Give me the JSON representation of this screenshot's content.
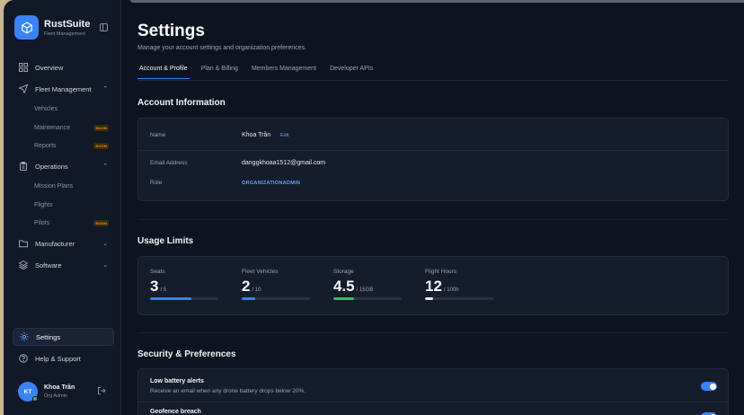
{
  "app": {
    "name": "RustSuite",
    "subtitle": "Fleet Management"
  },
  "sidebar": {
    "overview": "Overview",
    "fleet_management": {
      "label": "Fleet Management",
      "items": [
        {
          "label": "Vehicles",
          "badge": ""
        },
        {
          "label": "Maintenance",
          "badge": "SOON"
        },
        {
          "label": "Reports",
          "badge": "SOON"
        }
      ]
    },
    "operations": {
      "label": "Operations",
      "items": [
        {
          "label": "Mission Plans",
          "badge": ""
        },
        {
          "label": "Flights",
          "badge": ""
        },
        {
          "label": "Pilots",
          "badge": "SOON"
        }
      ]
    },
    "manufacturer": "Manufacturer",
    "software": "Software",
    "settings": "Settings",
    "help": "Help & Support",
    "user": {
      "initials": "KT",
      "name": "Khoa Trần",
      "role": "Org Admin"
    }
  },
  "page": {
    "title": "Settings",
    "subtitle": "Manage your account settings and organization preferences.",
    "tabs": [
      "Account & Profile",
      "Plan & Billing",
      "Members Management",
      "Developer APIs"
    ],
    "active_tab": "Account & Profile"
  },
  "account": {
    "title": "Account Information",
    "name_label": "Name",
    "name_value": "Khoa Trần",
    "edit_label": "Edit",
    "email_label": "Email Address",
    "email_value": "danggkhoaa1512@gmail.com",
    "role_label": "Role",
    "role_value": "ORGANIZATIONADMIN"
  },
  "usage": {
    "title": "Usage Limits",
    "metrics": [
      {
        "label": "Seats",
        "value": "3",
        "limit": "/ 5",
        "fraction": 0.6,
        "color": "#3b82f6"
      },
      {
        "label": "Fleet Vehicles",
        "value": "2",
        "limit": "/ 10",
        "fraction": 0.2,
        "color": "#3b82f6"
      },
      {
        "label": "Storage",
        "value": "4.5",
        "limit": "/ 15GB",
        "fraction": 0.3,
        "color": "#22c55e"
      },
      {
        "label": "Flight Hours",
        "value": "12",
        "limit": "/ 100h",
        "fraction": 0.12,
        "color": "#e5e7eb"
      }
    ]
  },
  "security": {
    "title": "Security & Preferences",
    "prefs": [
      {
        "title": "Low battery alerts",
        "desc": "Receive an email when any drone battery drops below 20%.",
        "enabled": true
      },
      {
        "title": "Geofence breach",
        "desc": "",
        "enabled": true
      }
    ]
  }
}
